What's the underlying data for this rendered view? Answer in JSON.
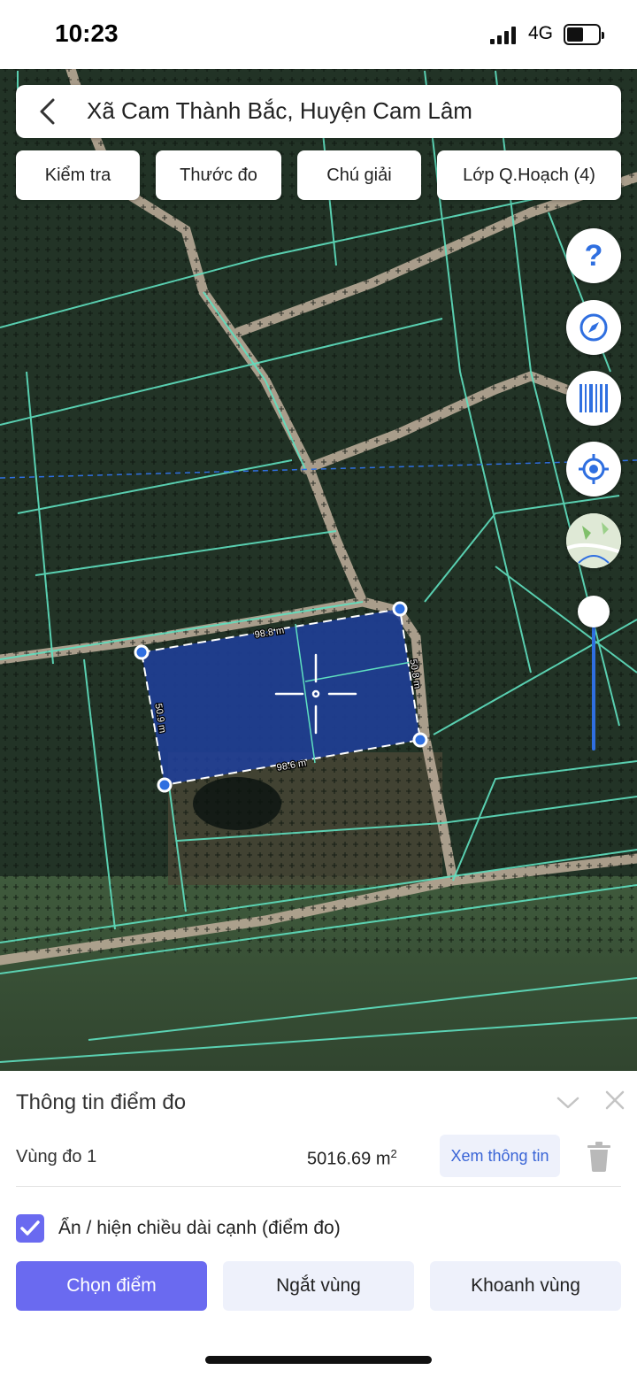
{
  "status_bar": {
    "time": "10:23",
    "network": "4G"
  },
  "search": {
    "title": "Xã Cam Thành Bắc, Huyện Cam Lâm"
  },
  "chips": [
    {
      "label": "Kiểm tra"
    },
    {
      "label": "Thước đo"
    },
    {
      "label": "Chú giải"
    },
    {
      "label": "Lớp Q.Hoạch (4)"
    }
  ],
  "side_buttons": {
    "help_label": "?",
    "icons": [
      "help-icon",
      "compass-icon",
      "barcode-icon",
      "locate-icon",
      "map-layer-icon"
    ]
  },
  "measurement": {
    "edges": {
      "top": "98.8 m",
      "bottom": "98.6 m",
      "left": "50.9 m",
      "right": "50.8 m"
    }
  },
  "panel": {
    "title": "Thông tin điểm đo",
    "zone_name": "Vùng đo 1",
    "zone_area": "5016.69 m",
    "zone_area_unit_sup": "2",
    "info_button": "Xem thông tin",
    "checkbox_label": "Ẩn / hiện chiều dài cạnh (điểm đo)",
    "checkbox_checked": true,
    "buttons": {
      "select_point": "Chọn điểm",
      "break_zone": "Ngắt vùng",
      "enclose_zone": "Khoanh vùng"
    }
  },
  "colors": {
    "accent": "#6a6af0",
    "link_blue": "#2f6fe0",
    "polygon_fill": "#1f3f9a",
    "parcel_lines": "#5fe0c0",
    "secondary_button_bg": "#eef1fb"
  }
}
